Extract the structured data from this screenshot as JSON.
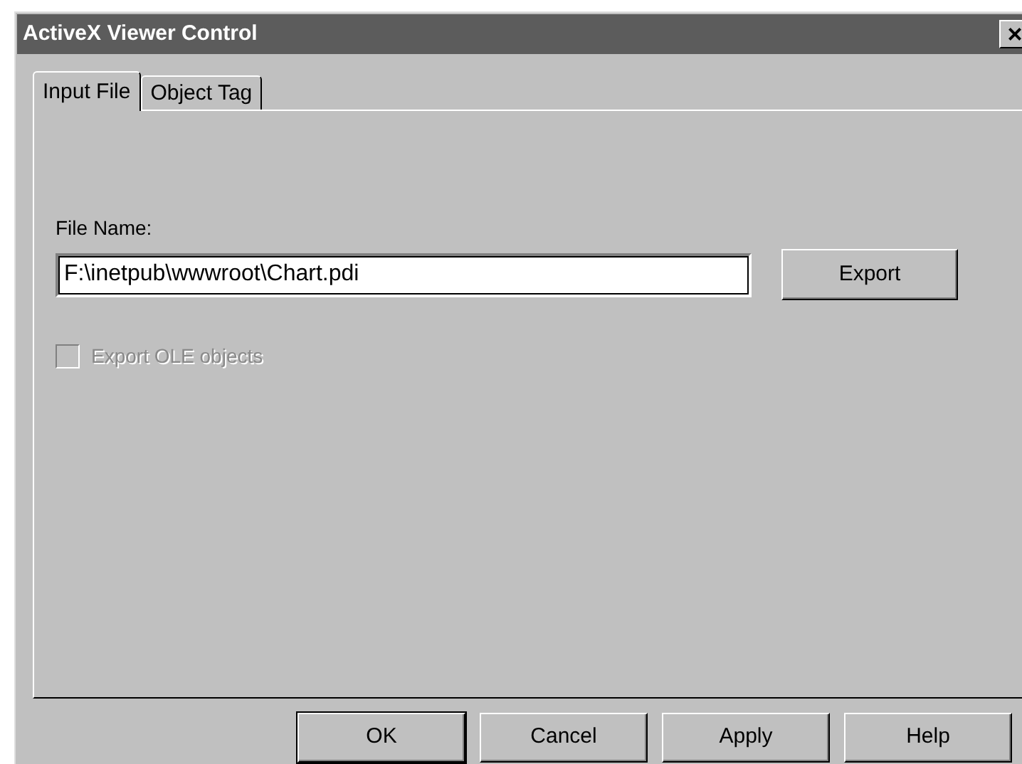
{
  "window": {
    "title": "ActiveX Viewer Control",
    "close": "×"
  },
  "tabs": [
    {
      "label": "Input File",
      "selected": true
    },
    {
      "label": "Object Tag",
      "selected": false
    }
  ],
  "file_name": {
    "label": "File Name:",
    "value": "F:\\inetpub\\wwwroot\\Chart.pdi"
  },
  "export_button": {
    "label": "Export"
  },
  "export_ole": {
    "label": "Export OLE objects",
    "checked": false,
    "disabled": true
  },
  "buttons": [
    {
      "label": "OK",
      "default": true
    },
    {
      "label": "Cancel",
      "default": false
    },
    {
      "label": "Apply",
      "default": false
    },
    {
      "label": "Help",
      "default": false
    }
  ]
}
